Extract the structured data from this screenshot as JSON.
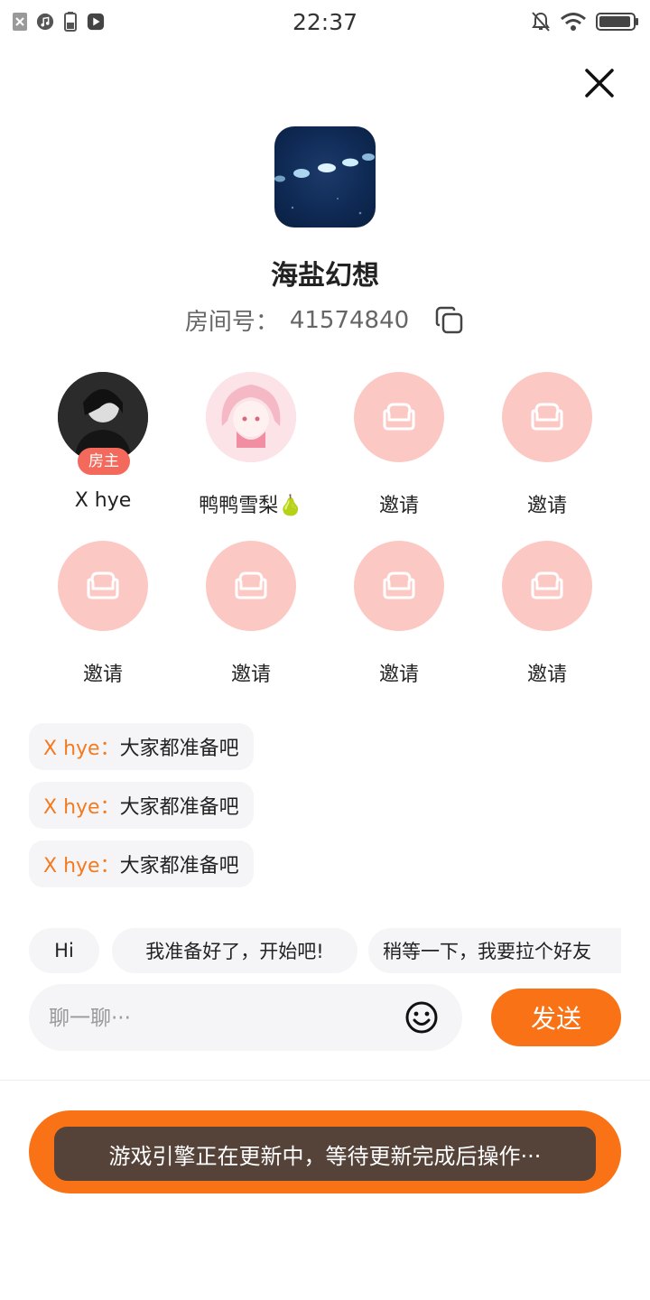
{
  "status_bar": {
    "time": "22:37",
    "left_icons": [
      "close-notification-icon",
      "music-icon",
      "battery-small-icon",
      "play-icon"
    ],
    "right_icons": [
      "mute-bell-icon",
      "wifi-icon",
      "battery-icon"
    ]
  },
  "room": {
    "game_title": "海盐幻想",
    "room_label": "房间号：",
    "room_number": "41574840"
  },
  "seats": [
    {
      "label": "X hye",
      "state": "occupied",
      "host_badge": "房主"
    },
    {
      "label": "鸭鸭雪梨🍐",
      "state": "occupied"
    },
    {
      "label": "邀请",
      "state": "empty"
    },
    {
      "label": "邀请",
      "state": "empty"
    },
    {
      "label": "邀请",
      "state": "empty"
    },
    {
      "label": "邀请",
      "state": "empty"
    },
    {
      "label": "邀请",
      "state": "empty"
    },
    {
      "label": "邀请",
      "state": "empty"
    }
  ],
  "chat": {
    "messages": [
      {
        "user": "X hye：",
        "text": "大家都准备吧"
      },
      {
        "user": "X hye：",
        "text": "大家都准备吧"
      },
      {
        "user": "X hye：",
        "text": "大家都准备吧"
      }
    ],
    "quick_replies": [
      "Hi",
      "我准备好了，开始吧!",
      "稍等一下，我要拉个好友"
    ],
    "input_placeholder": "聊一聊···",
    "send_label": "发送"
  },
  "toast": {
    "text": "游戏引擎正在更新中，等待更新完成后操作···"
  },
  "colors": {
    "accent": "#f97316",
    "seat_empty": "#fcc8c4",
    "host_badge": "#f36a5d",
    "chat_username": "#f47a1f"
  }
}
